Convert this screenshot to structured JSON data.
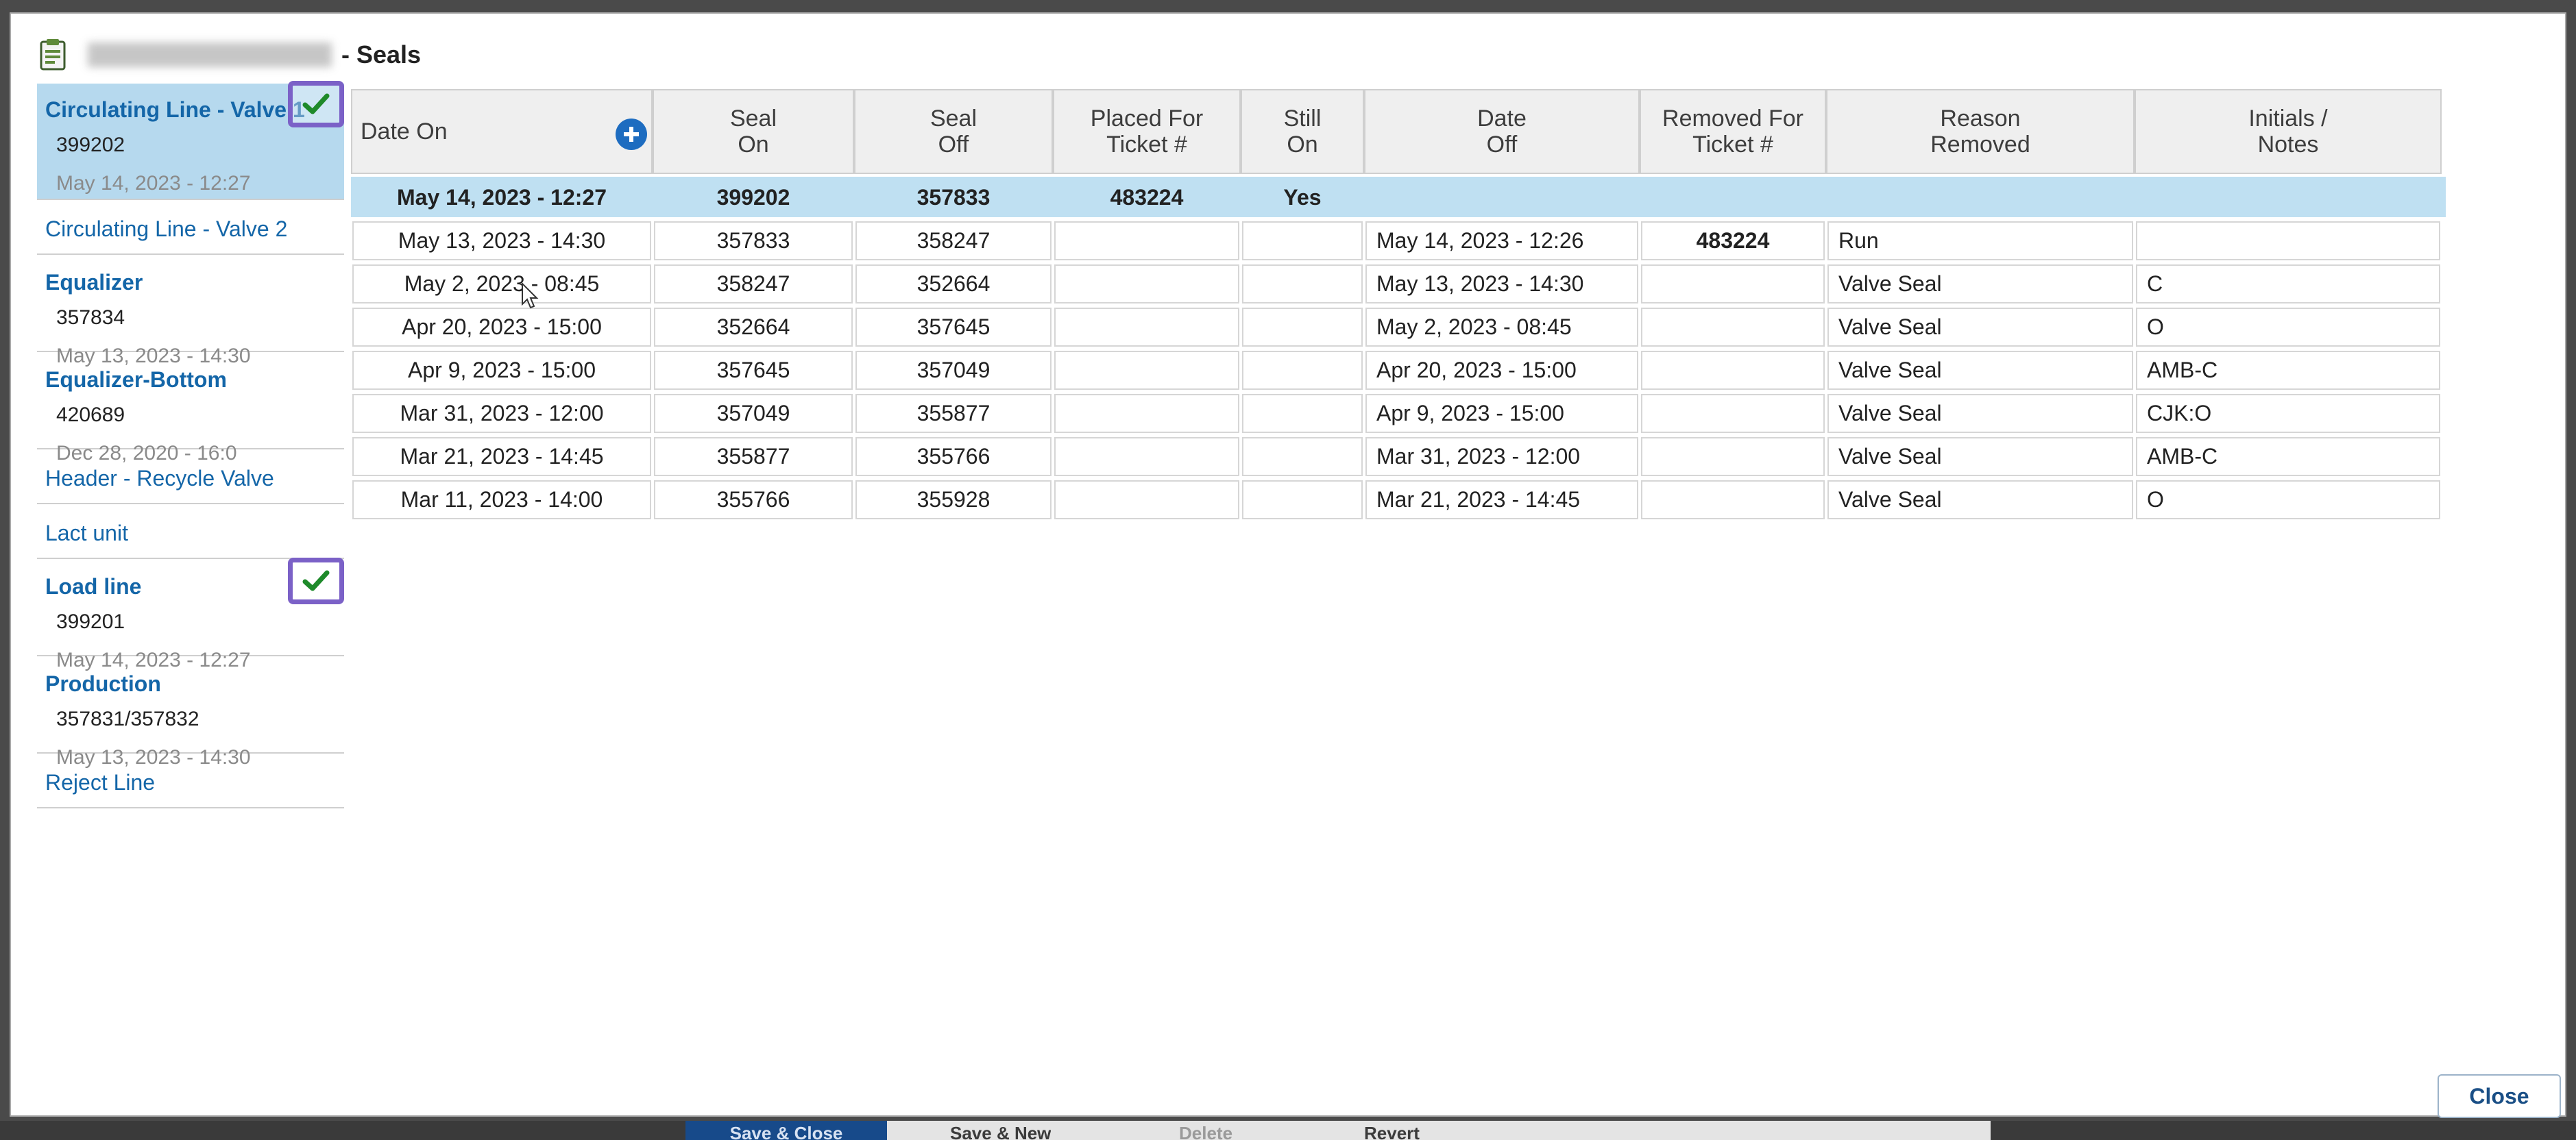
{
  "background": {
    "toolbar": {
      "save_close": "Save & Close",
      "save_new": "Save & New",
      "delete": "Delete",
      "revert": "Revert"
    }
  },
  "dialog": {
    "title": "- Seals",
    "close_label": "Close"
  },
  "sidebar": {
    "items": [
      {
        "name": "Circulating Line - Valve 1",
        "seal": "399202",
        "date": "May 14, 2023 - 12:27",
        "selected": true,
        "checked": true
      },
      {
        "name": "Circulating Line - Valve 2"
      },
      {
        "name": "Equalizer",
        "seal": "357834",
        "date": "May 13, 2023 - 14:30"
      },
      {
        "name": "Equalizer-Bottom",
        "seal": "420689",
        "date": "Dec 28, 2020 - 16:0"
      },
      {
        "name": "Header - Recycle Valve"
      },
      {
        "name": "Lact unit"
      },
      {
        "name": "Load line",
        "seal": "399201",
        "date": "May 14, 2023 - 12:27",
        "checked": true
      },
      {
        "name": "Production",
        "seal": "357831/357832",
        "date": "May 13, 2023 - 14:30"
      },
      {
        "name": "Reject Line"
      }
    ]
  },
  "table": {
    "columns": [
      {
        "line1": "Date On",
        "line2": ""
      },
      {
        "line1": "Seal",
        "line2": "On"
      },
      {
        "line1": "Seal",
        "line2": "Off"
      },
      {
        "line1": "Placed For",
        "line2": "Ticket #"
      },
      {
        "line1": "Still",
        "line2": "On"
      },
      {
        "line1": "Date",
        "line2": "Off"
      },
      {
        "line1": "Removed For",
        "line2": "Ticket #"
      },
      {
        "line1": "Reason",
        "line2": "Removed"
      },
      {
        "line1": "Initials /",
        "line2": "Notes"
      }
    ],
    "rows": [
      [
        "May 14, 2023 - 12:27",
        "399202",
        "357833",
        "483224",
        "Yes",
        "",
        "",
        "",
        ""
      ],
      [
        "May 13, 2023 - 14:30",
        "357833",
        "358247",
        "",
        "",
        "May 14, 2023 - 12:26",
        "483224",
        "Run",
        ""
      ],
      [
        "May 2, 2023 - 08:45",
        "358247",
        "352664",
        "",
        "",
        "May 13, 2023 - 14:30",
        "",
        "Valve Seal",
        "C"
      ],
      [
        "Apr 20, 2023 - 15:00",
        "352664",
        "357645",
        "",
        "",
        "May 2, 2023 - 08:45",
        "",
        "Valve Seal",
        "O"
      ],
      [
        "Apr 9, 2023 - 15:00",
        "357645",
        "357049",
        "",
        "",
        "Apr 20, 2023 - 15:00",
        "",
        "Valve Seal",
        "AMB-C"
      ],
      [
        "Mar 31, 2023 - 12:00",
        "357049",
        "355877",
        "",
        "",
        "Apr 9, 2023 - 15:00",
        "",
        "Valve Seal",
        "CJK:O"
      ],
      [
        "Mar 21, 2023 - 14:45",
        "355877",
        "355766",
        "",
        "",
        "Mar 31, 2023 - 12:00",
        "",
        "Valve Seal",
        "AMB-C"
      ],
      [
        "Mar 11, 2023 - 14:00",
        "355766",
        "355928",
        "",
        "",
        "Mar 21, 2023 - 14:45",
        "",
        "Valve Seal",
        "O"
      ]
    ]
  }
}
